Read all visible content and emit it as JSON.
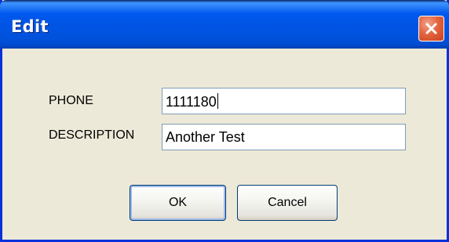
{
  "dialog": {
    "title": "Edit",
    "close_icon": "close-icon"
  },
  "form": {
    "phone_label": "PHONE",
    "phone_value": "1111180",
    "description_label": "DESCRIPTION",
    "description_value": "Another Test"
  },
  "buttons": {
    "ok_label": "OK",
    "cancel_label": "Cancel"
  },
  "colors": {
    "titlebar": "#0054e3",
    "close_button": "#e3643f",
    "window_background": "#ece9d8",
    "field_border": "#7f9db9"
  }
}
